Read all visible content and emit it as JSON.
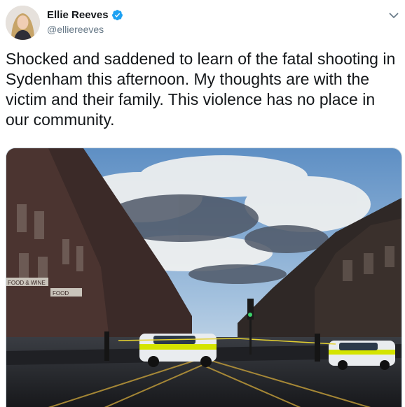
{
  "user": {
    "name": "Ellie Reeves",
    "handle": "@elliereeves",
    "verified": true
  },
  "tweet": {
    "text": "Shocked and saddened to learn of the fatal shooting in Sydenham this afternoon. My thoughts are with the victim and their family. This violence has no place in our community."
  },
  "icons": {
    "verified": "verified-badge-icon",
    "menu": "chevron-down-icon"
  },
  "colors": {
    "verified": "#1da1f2",
    "handle": "#657786",
    "text": "#14171a"
  },
  "photo_signs": {
    "shop_left": "FOOD & WINE",
    "shop_left_2": "FOOD"
  }
}
